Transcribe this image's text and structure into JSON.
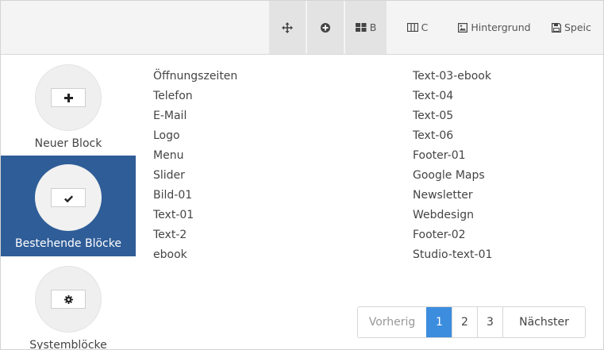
{
  "toolbar": {
    "buttons": [
      {
        "id": "move",
        "icon": "move-arrows-icon",
        "label": ""
      },
      {
        "id": "add",
        "icon": "plus-circle-icon",
        "label": ""
      },
      {
        "id": "layout_b",
        "icon": "grid-blocks-icon",
        "label": "B"
      },
      {
        "id": "layout_c",
        "icon": "columns-icon",
        "label": "C"
      },
      {
        "id": "background",
        "icon": "image-icon",
        "label": "Hintergrund"
      },
      {
        "id": "save",
        "icon": "floppy-disk-icon",
        "label": "Speic"
      }
    ]
  },
  "sidebar": {
    "items": [
      {
        "label": "Neuer Block",
        "icon": "plus-icon",
        "active": false
      },
      {
        "label": "Bestehende Blöcke",
        "icon": "check-icon",
        "active": true
      },
      {
        "label": "Systemblöcke",
        "icon": "gear-icon",
        "active": false
      }
    ],
    "accent_color": "#2f5d98"
  },
  "blocks": {
    "column1": [
      "Öffnungszeiten",
      "Telefon",
      "E-Mail",
      "Logo",
      "Menu",
      "Slider",
      "Bild-01",
      "Text-01",
      "Text-2",
      "ebook"
    ],
    "column2": [
      "Text-03-ebook",
      "Text-04",
      "Text-05",
      "Text-06",
      "Footer-01",
      "Google Maps",
      "Newsletter",
      "Webdesign",
      "Footer-02",
      "Studio-text-01"
    ]
  },
  "pagination": {
    "prev_label": "Vorherig",
    "pages": [
      "1",
      "2",
      "3"
    ],
    "current_page": "1",
    "next_label": "Nächster",
    "active_color": "#3c8dde"
  }
}
